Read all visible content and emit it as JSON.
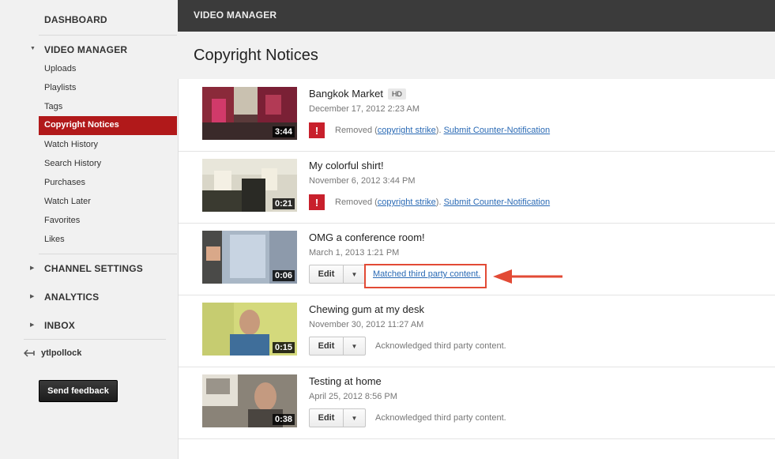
{
  "sidebar": {
    "dashboard": "DASHBOARD",
    "video_manager": "VIDEO MANAGER",
    "items": [
      "Uploads",
      "Playlists",
      "Tags",
      "Copyright Notices",
      "Watch History",
      "Search History",
      "Purchases",
      "Watch Later",
      "Favorites",
      "Likes"
    ],
    "channel_settings": "CHANNEL SETTINGS",
    "analytics": "ANALYTICS",
    "inbox": "INBOX",
    "username": "ytlpollock",
    "feedback": "Send feedback"
  },
  "topbar": {
    "title": "VIDEO MANAGER"
  },
  "page": {
    "title": "Copyright Notices"
  },
  "videos": [
    {
      "title": "Bangkok Market",
      "badge": "HD",
      "date": "December 17, 2012 2:23 AM",
      "duration": "3:44",
      "status_prefix": "Removed (",
      "status_link": "copyright strike",
      "status_suffix": ").",
      "action": "Submit Counter-Notification"
    },
    {
      "title": "My colorful shirt!",
      "date": "November 6, 2012 3:44 PM",
      "duration": "0:21",
      "status_prefix": "Removed (",
      "status_link": "copyright strike",
      "status_suffix": ").",
      "action": "Submit Counter-Notification"
    },
    {
      "title": "OMG a conference room!",
      "date": "March 1, 2013 1:21 PM",
      "duration": "0:06",
      "edit": "Edit",
      "status": "Matched third party content."
    },
    {
      "title": "Chewing gum at my desk",
      "date": "November 30, 2012 11:27 AM",
      "duration": "0:15",
      "edit": "Edit",
      "status": "Acknowledged third party content."
    },
    {
      "title": "Testing at home",
      "date": "April 25, 2012 8:56 PM",
      "duration": "0:38",
      "edit": "Edit",
      "status": "Acknowledged third party content."
    }
  ],
  "colors": {
    "accent": "#b1191a",
    "alert": "#c8202c",
    "link": "#2a6ab5",
    "annotation": "#e24a35"
  }
}
